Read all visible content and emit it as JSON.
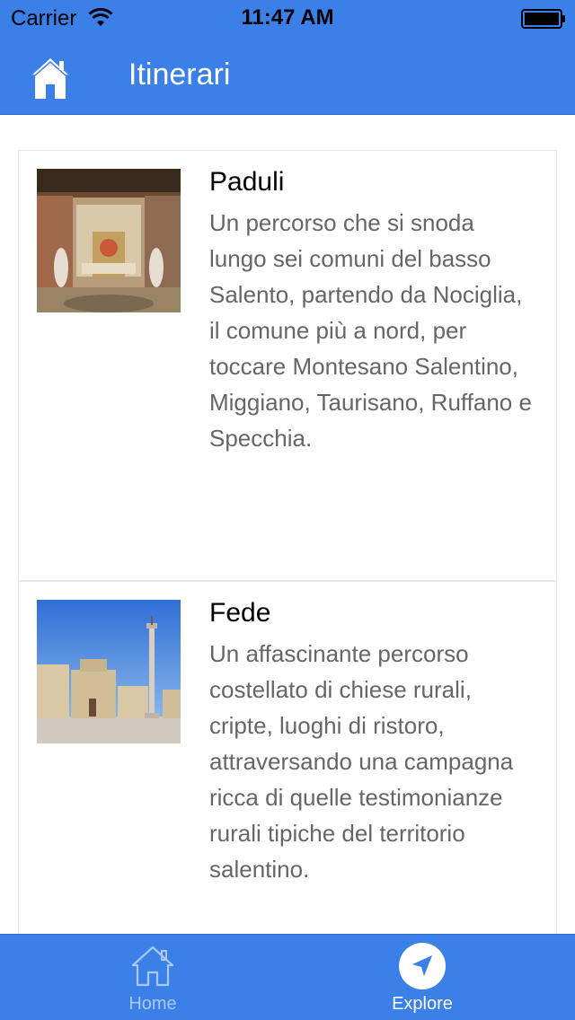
{
  "status_bar": {
    "carrier": "Carrier",
    "time": "11:47 AM",
    "icons": [
      "wifi-icon",
      "battery-icon"
    ]
  },
  "nav_bar": {
    "title": "Itinerari",
    "left_icon": "home-icon"
  },
  "itineraries": [
    {
      "title": "Paduli",
      "description": "Un percorso che si snoda lungo sei comuni del basso Salento, partendo da Nociglia, il comune più a nord, per toccare Montesano Salentino, Miggiano, Taurisano, Ruffano e Specchia."
    },
    {
      "title": "Fede",
      "description": "Un affascinante percorso costellato di chiese rurali, cripte, luoghi di ristoro, attraversando una campagna ricca di quelle testimonianze rurali tipiche del territorio salentino."
    }
  ],
  "tab_bar": {
    "tabs": [
      {
        "label": "Home",
        "icon": "home-outline-icon",
        "selected": false
      },
      {
        "label": "Explore",
        "icon": "navigation-arrow-icon",
        "selected": true
      }
    ]
  },
  "colors": {
    "primary": "#3a80e8",
    "text_primary": "#000000",
    "text_secondary": "#666666",
    "tab_inactive": "#a9c8f5"
  }
}
